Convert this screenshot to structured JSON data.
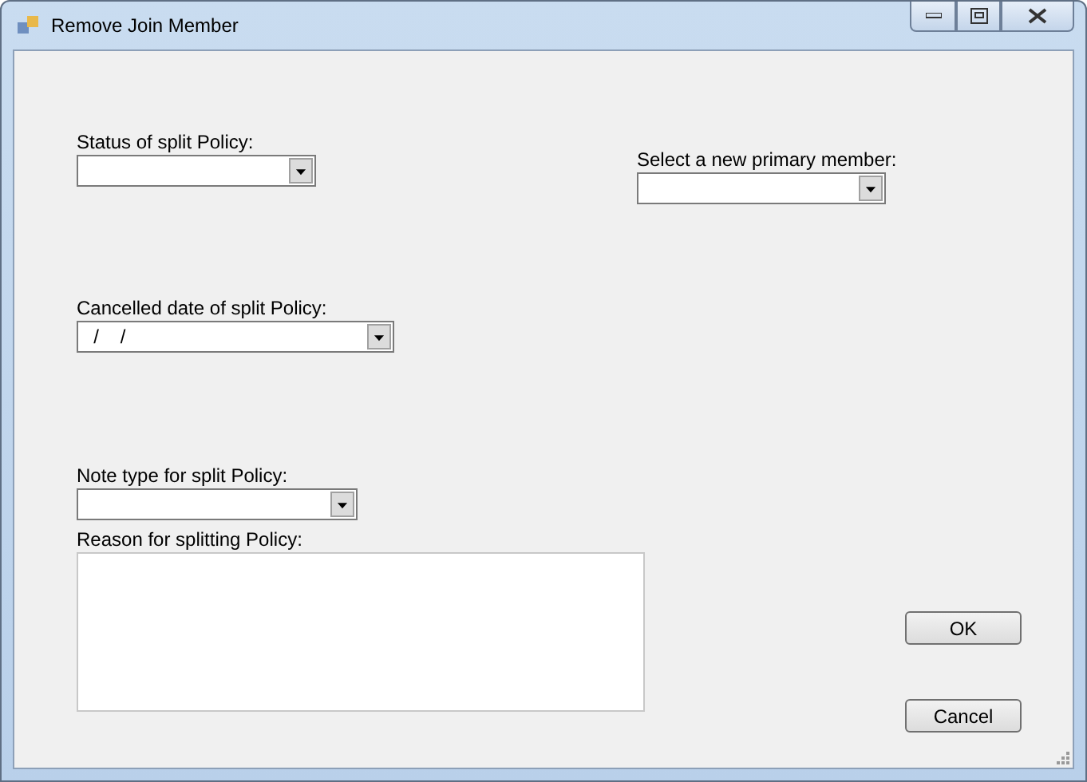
{
  "window": {
    "title": "Remove Join Member"
  },
  "fields": [
    {
      "kind": "combo",
      "label": "Status of split Policy:"
    },
    {
      "kind": "combo",
      "label": "Cancelled date of split Policy:",
      "value": "  /    /"
    },
    {
      "kind": "combo",
      "label": "Note type for split Policy:"
    },
    {
      "kind": "memo",
      "label": "Reason for splitting Policy:"
    }
  ],
  "primary_member": {
    "label": "Select a new primary member:"
  },
  "buttons": [
    "OK",
    "Cancel"
  ]
}
